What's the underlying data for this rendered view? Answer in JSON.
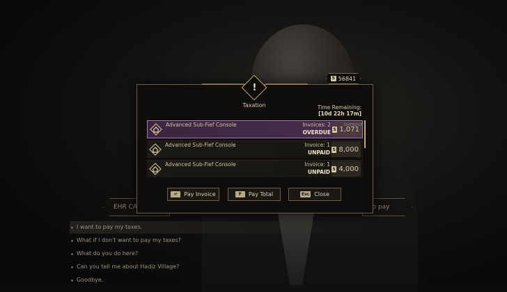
{
  "background": {
    "left_pill": "EHR CA",
    "right_pill": "to pay",
    "dialogue": [
      "I want to pay my taxes.",
      "What if I don't want to pay my taxes?",
      "What do you do here?",
      "Can you tell me about Hadiz Village?",
      "Goodbye."
    ]
  },
  "currency": {
    "icon": "coin-icon",
    "amount": "56841"
  },
  "modal": {
    "title": "Taxation",
    "time_label": "Time Remaining:",
    "time_value": "[10d 22h 17m]",
    "rows": [
      {
        "name": "Advanced Sub-Fief Console",
        "invoices": "Invoices: 2",
        "status": "OVERDUE",
        "amount": "1,071",
        "overdue_note": "OVERDUE"
      },
      {
        "name": "Advanced Sub-Fief Console",
        "invoices": "Invoice: 1",
        "status": "UNPAID",
        "amount": "8,000"
      },
      {
        "name": "Advanced Sub-Fief Console",
        "invoices": "Invoice: 1",
        "status": "UNPAID",
        "amount": "4,000"
      }
    ],
    "buttons": {
      "pay_invoice": {
        "key": "Enter",
        "label": "Pay Invoice"
      },
      "pay_total": {
        "key": "F",
        "label": "Pay Total"
      },
      "close": {
        "key": "Esc",
        "label": "Close"
      }
    }
  },
  "colors": {
    "accent_gold": "#c8a86a",
    "selected_row": "#4a2d50",
    "panel_bg": "#0e0d0c"
  }
}
